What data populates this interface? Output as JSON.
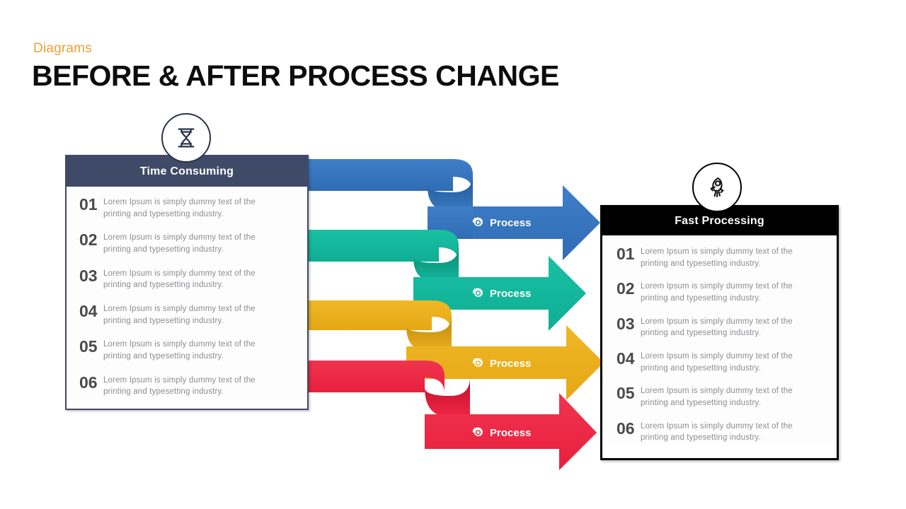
{
  "header": {
    "kicker": "Diagrams",
    "title": "BEFORE & AFTER PROCESS CHANGE"
  },
  "left_panel": {
    "badge_icon": "hourglass-icon",
    "heading": "Time Consuming",
    "header_color": "#3f4a68",
    "border_color": "#3f4a68",
    "items": [
      {
        "num": "01",
        "text": "Lorem Ipsum is simply dummy text of the printing and typesetting industry."
      },
      {
        "num": "02",
        "text": "Lorem Ipsum is simply dummy text of the printing and typesetting industry."
      },
      {
        "num": "03",
        "text": "Lorem Ipsum is simply dummy text of the printing and typesetting industry."
      },
      {
        "num": "04",
        "text": "Lorem Ipsum is simply dummy text of the printing and typesetting industry."
      },
      {
        "num": "05",
        "text": "Lorem Ipsum is simply dummy text of the printing and typesetting industry."
      },
      {
        "num": "06",
        "text": "Lorem Ipsum is simply dummy text of the printing and typesetting industry."
      }
    ]
  },
  "right_panel": {
    "badge_icon": "rocket-icon",
    "heading": "Fast Processing",
    "header_color": "#000000",
    "border_color": "#000000",
    "items": [
      {
        "num": "01",
        "text": "Lorem Ipsum is simply dummy text of the printing and typesetting industry."
      },
      {
        "num": "02",
        "text": "Lorem Ipsum is simply dummy text of the printing and typesetting industry."
      },
      {
        "num": "03",
        "text": "Lorem Ipsum is simply dummy text of the printing and typesetting industry."
      },
      {
        "num": "04",
        "text": "Lorem Ipsum is simply dummy text of the printing and typesetting industry."
      },
      {
        "num": "05",
        "text": "Lorem Ipsum is simply dummy text of the printing and typesetting industry."
      },
      {
        "num": "06",
        "text": "Lorem Ipsum is simply dummy text of the printing and typesetting industry."
      }
    ]
  },
  "arrows": [
    {
      "label": "Process",
      "icon": "gear-icon",
      "color": "#3574c0",
      "shade": "#2e63a6"
    },
    {
      "label": "Process",
      "icon": "gear-icon",
      "color": "#12b89c",
      "shade": "#0e9d85"
    },
    {
      "label": "Process",
      "icon": "gear-icon",
      "color": "#edb01f",
      "shade": "#cc9512"
    },
    {
      "label": "Process",
      "icon": "gear-icon",
      "color": "#ed2945",
      "shade": "#cc1733"
    }
  ]
}
